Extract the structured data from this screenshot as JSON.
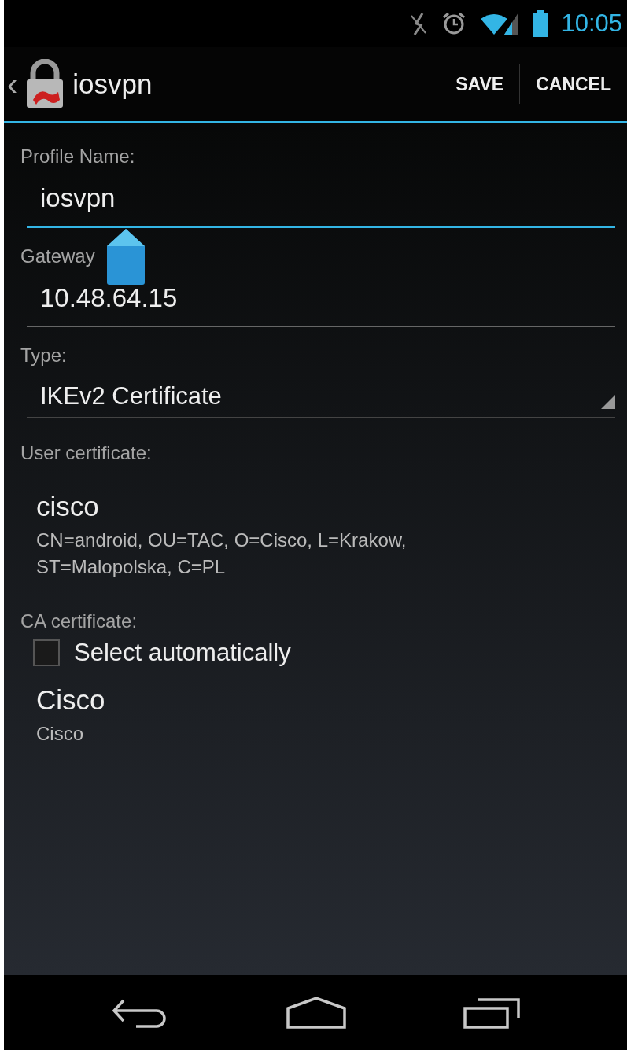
{
  "status_bar": {
    "time": "10:05"
  },
  "action_bar": {
    "back": "‹",
    "title": "iosvpn",
    "actions": [
      "SAVE",
      "CANCEL"
    ]
  },
  "form": [
    {
      "kind": "text",
      "label": "Profile Name:",
      "value": "iosvpn",
      "focused": true
    },
    {
      "kind": "text",
      "label": "Gateway",
      "value": "10.48.64.15",
      "focused": false
    },
    {
      "kind": "dropdown",
      "label": "Type:",
      "value": "IKEv2 Certificate"
    },
    {
      "kind": "choice",
      "label": "User certificate:",
      "title": "cisco",
      "detail": "CN=android, OU=TAC, O=Cisco, L=Krakow, ST=Malopolska, C=PL"
    },
    {
      "kind": "checkbox",
      "label": "CA certificate:",
      "text": "Select automatically",
      "checked": false
    },
    {
      "kind": "choice",
      "title": "Cisco",
      "detail": "Cisco"
    }
  ]
}
